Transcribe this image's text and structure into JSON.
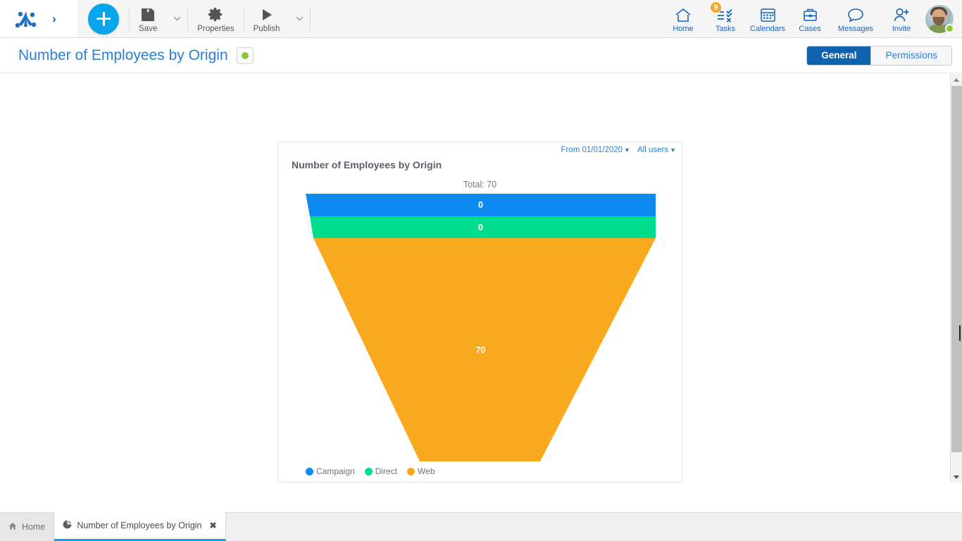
{
  "toolbar": {
    "logo_icon": "bitrix-logo-icon",
    "expand_icon": "chevron-right-icon",
    "add_button_label": "+",
    "items": [
      {
        "label": "Save",
        "icon": "floppy-disk-icon",
        "has_caret": true
      },
      {
        "label": "Properties",
        "icon": "gear-icon",
        "has_caret": false
      },
      {
        "label": "Publish",
        "icon": "play-icon",
        "has_caret": true
      }
    ],
    "nav": [
      {
        "label": "Home",
        "icon": "home-icon",
        "badge": ""
      },
      {
        "label": "Tasks",
        "icon": "tasks-checklist-icon",
        "badge": "9"
      },
      {
        "label": "Calendars",
        "icon": "calendar-icon",
        "badge": ""
      },
      {
        "label": "Cases",
        "icon": "briefcase-icon",
        "badge": ""
      },
      {
        "label": "Messages",
        "icon": "speech-bubble-icon",
        "badge": ""
      },
      {
        "label": "Invite",
        "icon": "user-plus-icon",
        "badge": ""
      }
    ],
    "avatar_name": "user-avatar",
    "status": "online"
  },
  "page_header": {
    "title": "Number of Employees by Origin",
    "flag_color": "#8dc63f",
    "tabs": [
      {
        "label": "General",
        "active": true
      },
      {
        "label": "Permissions",
        "active": false
      }
    ]
  },
  "widget": {
    "title": "Number of Employees by Origin",
    "filters": [
      {
        "label": "From 01/01/2020"
      },
      {
        "label": "All users"
      }
    ],
    "total_label": "Total: 70"
  },
  "chart_data": {
    "type": "funnel",
    "title": "Number of Employees by Origin",
    "total": 70,
    "categories": [
      "Campaign",
      "Direct",
      "Web"
    ],
    "values": [
      0,
      0,
      70
    ],
    "labels": [
      "0",
      "0",
      "70"
    ],
    "colors": [
      "#0d8bf2",
      "#00dd8c",
      "#f9a91e"
    ],
    "legend_position": "bottom-left",
    "grid": false,
    "xlabel": "",
    "ylabel": ""
  },
  "scrollbar": {
    "up_icon": "triangle-up-icon",
    "down_icon": "triangle-down-icon"
  },
  "taskbar": {
    "tabs": [
      {
        "label": "Home",
        "icon": "home-small-icon",
        "active": false,
        "closable": false
      },
      {
        "label": "Number of Employees by Origin",
        "icon": "pie-chart-icon",
        "active": true,
        "closable": true,
        "close_glyph": "✖"
      }
    ]
  }
}
